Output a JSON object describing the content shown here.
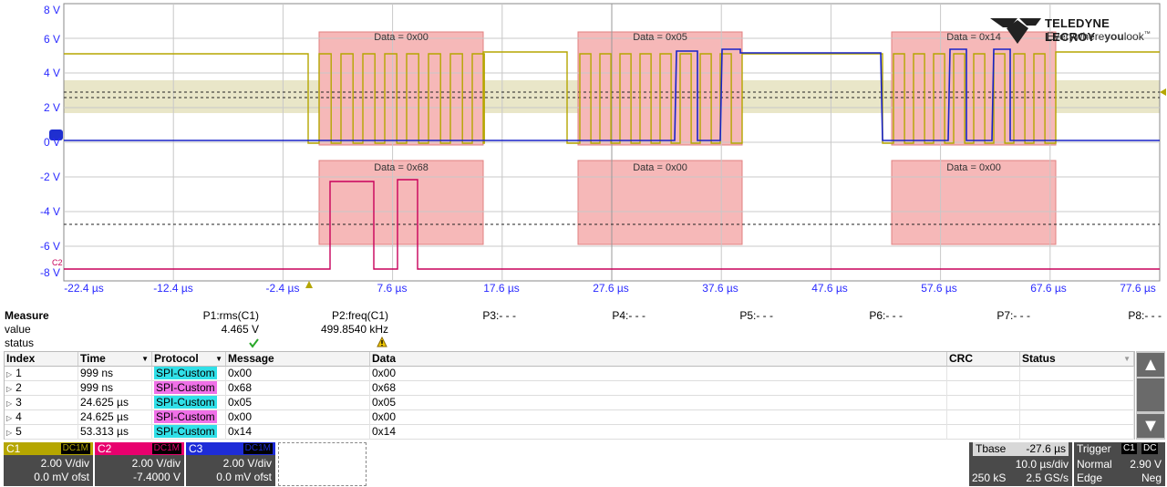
{
  "scope": {
    "y_labels": [
      "8 V",
      "6 V",
      "4 V",
      "2 V",
      "0 V",
      "-2 V",
      "-4 V",
      "-6 V",
      "-8 V"
    ],
    "x_labels": [
      "-22.4 µs",
      "-12.4 µs",
      "-2.4 µs",
      "7.6 µs",
      "17.6 µs",
      "27.6 µs",
      "37.6 µs",
      "47.6 µs",
      "57.6 µs",
      "67.6 µs",
      "77.6 µs"
    ],
    "c2_marker": "C2",
    "decode_top": [
      "Data = 0x00",
      "Data = 0x05",
      "Data = 0x14"
    ],
    "decode_bottom": [
      "Data = 0x68",
      "Data = 0x00",
      "Data = 0x00"
    ],
    "colors": {
      "c1": "#b5a600",
      "c2": "#c8005a",
      "c3": "#1822c8",
      "decode_box": "#f6b8b8",
      "threshold_band": "#e9e6c8"
    }
  },
  "logo": {
    "brand": "TELEDYNE LECROY",
    "tagline": "Everywhereyoulook",
    "tag_pre": "Everywhere",
    "tag_bold": "you",
    "tag_post": "look",
    "tm": "™"
  },
  "measure": {
    "title": "Measure",
    "rows": {
      "value": "value",
      "status": "status"
    },
    "params": [
      {
        "label": "P1:rms(C1)",
        "value": "4.465 V",
        "status": "check-icon"
      },
      {
        "label": "P2:freq(C1)",
        "value": "499.8540 kHz",
        "status": "warning-icon"
      },
      {
        "label": "P3:- - -",
        "value": "",
        "status": ""
      },
      {
        "label": "P4:- - -",
        "value": "",
        "status": ""
      },
      {
        "label": "P5:- - -",
        "value": "",
        "status": ""
      },
      {
        "label": "P6:- - -",
        "value": "",
        "status": ""
      },
      {
        "label": "P7:- - -",
        "value": "",
        "status": ""
      },
      {
        "label": "P8:- - -",
        "value": "",
        "status": ""
      }
    ]
  },
  "table": {
    "headers": [
      "Index",
      "Time",
      "Protocol",
      "Message",
      "Data",
      "CRC",
      "Status"
    ],
    "rows": [
      {
        "index": "1",
        "time": "999 ns",
        "protocol": "SPI-Custom",
        "message": "0x00",
        "data": "0x00",
        "color": "#30e0e8"
      },
      {
        "index": "2",
        "time": "999 ns",
        "protocol": "SPI-Custom",
        "message": "0x68",
        "data": "0x68",
        "color": "#f070e8"
      },
      {
        "index": "3",
        "time": "24.625 µs",
        "protocol": "SPI-Custom",
        "message": "0x05",
        "data": "0x05",
        "color": "#30e0e8"
      },
      {
        "index": "4",
        "time": "24.625 µs",
        "protocol": "SPI-Custom",
        "message": "0x00",
        "data": "0x00",
        "color": "#f070e8"
      },
      {
        "index": "5",
        "time": "53.313 µs",
        "protocol": "SPI-Custom",
        "message": "0x14",
        "data": "0x14",
        "color": "#30e0e8"
      }
    ]
  },
  "channels": [
    {
      "name": "C1",
      "coupling": "DC1M",
      "vdiv": "2.00 V/div",
      "offset": "0.0 mV ofst",
      "color": "#b5a600"
    },
    {
      "name": "C2",
      "coupling": "DC1M",
      "vdiv": "2.00 V/div",
      "offset": "-7.4000 V",
      "color": "#e8006e"
    },
    {
      "name": "C3",
      "coupling": "DC1M",
      "vdiv": "2.00 V/div",
      "offset": "0.0 mV ofst",
      "color": "#1e2cd8"
    }
  ],
  "timebase": {
    "label": "Tbase",
    "delay": "-27.6 µs",
    "tdiv": "10.0 µs/div",
    "samples": "250 kS",
    "rate": "2.5 GS/s"
  },
  "trigger": {
    "label": "Trigger",
    "source": "C1",
    "coupling": "DC",
    "mode": "Normal",
    "level": "2.90 V",
    "type": "Edge",
    "slope": "Neg"
  }
}
